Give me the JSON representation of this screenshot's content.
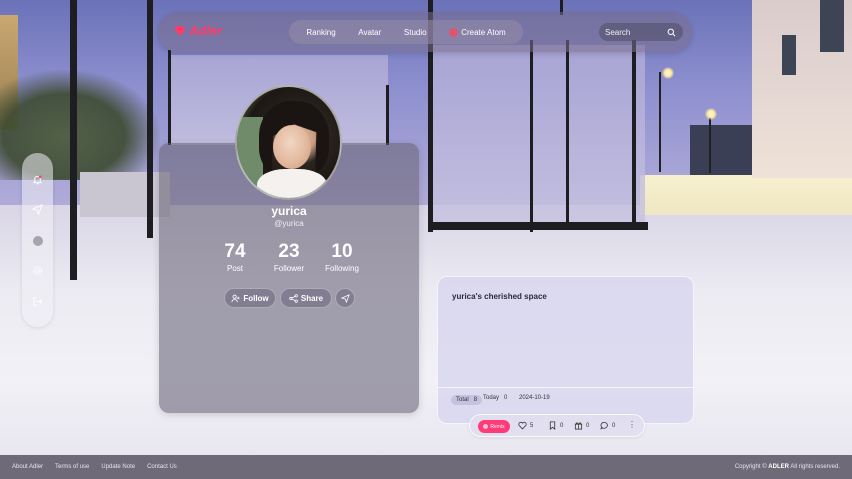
{
  "brand": {
    "name": "Adler",
    "color": "#ff3b6b"
  },
  "nav": {
    "items": [
      {
        "label": "Ranking"
      },
      {
        "label": "Avatar"
      },
      {
        "label": "Studio"
      },
      {
        "label": "Create Atom"
      }
    ],
    "search_placeholder": "Search"
  },
  "side_rail": {
    "icons": [
      "bell-icon",
      "send-icon",
      "dot-icon",
      "gear-icon",
      "logout-icon"
    ]
  },
  "profile": {
    "username": "yurica",
    "handle": "@yurica",
    "stats": [
      {
        "value": "74",
        "label": "Post"
      },
      {
        "value": "23",
        "label": "Follower"
      },
      {
        "value": "10",
        "label": "Following"
      }
    ],
    "buttons": {
      "follow": "Follow",
      "share": "Share"
    }
  },
  "space": {
    "title": "yurica's cherished space",
    "total_label": "Total",
    "total_value": "8",
    "today_label": "Today",
    "today_value": "0",
    "date": "2024-10-19",
    "remix_label": "Remix",
    "likes": "5",
    "bookmarks": "0",
    "gifts": "0",
    "comments": "0"
  },
  "footer": {
    "links": [
      "About Adler",
      "Terms of use",
      "Update Note",
      "Contact Us"
    ],
    "copyright_prefix": "Copyright ©",
    "copyright_brand": "ADLER",
    "copyright_suffix": "All rights reserved."
  }
}
